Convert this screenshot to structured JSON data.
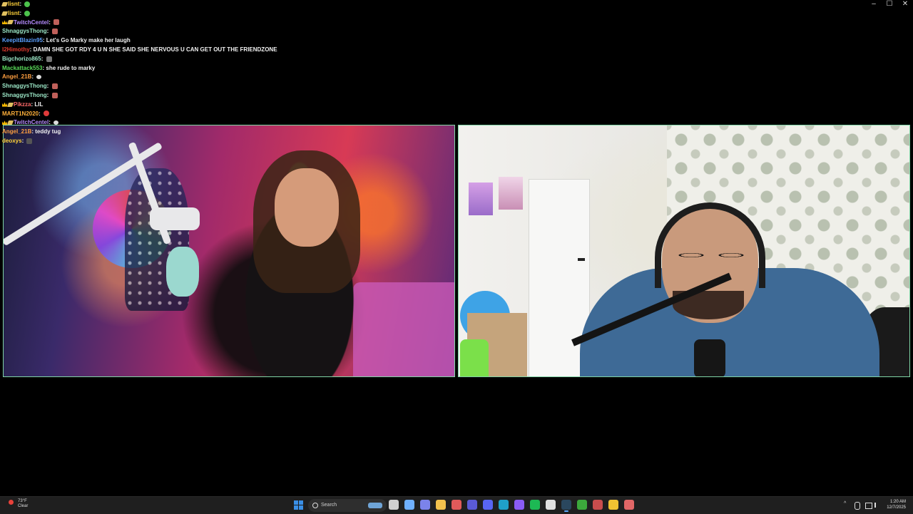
{
  "window": {
    "controls": [
      "–",
      "☐",
      "✕"
    ]
  },
  "chat": [
    {
      "user": "lisnt",
      "color": "#ffd23a",
      "badges": [
        "bits"
      ],
      "message": "",
      "emote": "grin"
    },
    {
      "user": "lisnt",
      "color": "#ffd23a",
      "badges": [
        "bits"
      ],
      "message": "",
      "emote": "grin"
    },
    {
      "user": "TwitchCentel",
      "color": "#b58cff",
      "badges": [
        "crown",
        "bits"
      ],
      "message": "",
      "emote": "face"
    },
    {
      "user": "ShnaggysThong",
      "color": "#9be6c6",
      "badges": [],
      "message": "",
      "emote": "face"
    },
    {
      "user": "KeepitBlazin95",
      "color": "#5aa0ff",
      "badges": [],
      "message": "Let's Go Marky make her laugh",
      "emote": ""
    },
    {
      "user": "l2Himothy",
      "color": "#e23b2f",
      "badges": [],
      "message": "DAMN SHE GOT RDY 4 U N SHE SAID SHE NERVOUS U CAN GET OUT THE FRIENDZONE",
      "emote": ""
    },
    {
      "user": "Bigchorizo865",
      "color": "#9be6c6",
      "badges": [],
      "message": "",
      "emote": "cat"
    },
    {
      "user": "Mackattack553",
      "color": "#5adf5a",
      "badges": [],
      "message": "she rude to marky",
      "emote": ""
    },
    {
      "user": "Angel_21B",
      "color": "#ff9f40",
      "badges": [],
      "message": "",
      "emote": "speech"
    },
    {
      "user": "ShnaggysThong",
      "color": "#9be6c6",
      "badges": [],
      "message": "",
      "emote": "face"
    },
    {
      "user": "ShnaggysThong",
      "color": "#9be6c6",
      "badges": [],
      "message": "",
      "emote": "face"
    },
    {
      "user": "Pikzza",
      "color": "#ff6a6a",
      "badges": [
        "crown",
        "bits"
      ],
      "message": "LIL",
      "emote": ""
    },
    {
      "user": "MART1N2020",
      "color": "#ffb03a",
      "badges": [],
      "message": "",
      "emote": "red"
    },
    {
      "user": "TwitchCentel",
      "color": "#b58cff",
      "badges": [
        "crown",
        "bits"
      ],
      "message": "",
      "emote": "speech"
    },
    {
      "user": "Angel_21B",
      "color": "#ff9f40",
      "badges": [],
      "message": "teddy tug",
      "emote": ""
    },
    {
      "user": "deoxys",
      "color": "#ffd23a",
      "badges": [],
      "message": "",
      "emote": "dark"
    }
  ],
  "taskbar": {
    "weather_temp": "73°F",
    "weather_desc": "Clear",
    "search_placeholder": "Search",
    "tray_chevron": "^",
    "time": "1:20 AM",
    "date": "12/7/2025",
    "apps": [
      {
        "name": "task-view-app",
        "color": "#d0d0d0",
        "active": false
      },
      {
        "name": "copilot-app",
        "color": "#6fb0ff",
        "active": false
      },
      {
        "name": "teams-app",
        "color": "#7b83eb",
        "active": false
      },
      {
        "name": "file-explorer-app",
        "color": "#f3c24d",
        "active": false
      },
      {
        "name": "media-app",
        "color": "#e05a5a",
        "active": false
      },
      {
        "name": "obs-app",
        "color": "#5a5ad6",
        "active": false
      },
      {
        "name": "discord-app",
        "color": "#5865f2",
        "active": false
      },
      {
        "name": "edge-app",
        "color": "#1fa0c8",
        "active": false
      },
      {
        "name": "purple-app",
        "color": "#8a5cf5",
        "active": false
      },
      {
        "name": "spotify-app",
        "color": "#1db954",
        "active": false
      },
      {
        "name": "capcut-app",
        "color": "#e0e0e0",
        "active": false
      },
      {
        "name": "steam-app",
        "color": "#2a475e",
        "active": true
      },
      {
        "name": "xbox-app",
        "color": "#3ca83c",
        "active": false
      },
      {
        "name": "game-launcher-app",
        "color": "#c94d4d",
        "active": false
      },
      {
        "name": "chrome-app",
        "color": "#f1c232",
        "active": false
      },
      {
        "name": "chrome-alt-app",
        "color": "#e06666",
        "active": false
      }
    ]
  }
}
